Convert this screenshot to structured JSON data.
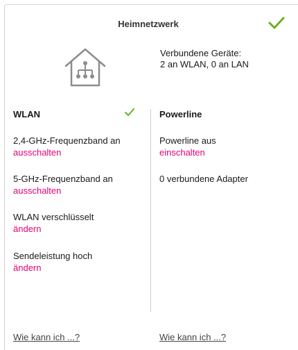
{
  "header": {
    "title": "Heimnetzwerk"
  },
  "summary": {
    "devices_line1": "Verbundene Geräte:",
    "devices_line2": "2 an WLAN, 0 an LAN"
  },
  "wlan": {
    "heading": "WLAN",
    "items": [
      {
        "status": "2,4-GHz-Frequenzband an",
        "action": "ausschalten"
      },
      {
        "status": "5-GHz-Frequenzband an",
        "action": "ausschalten"
      },
      {
        "status": "WLAN verschlüsselt",
        "action": "ändern"
      },
      {
        "status": "Sendeleistung hoch",
        "action": "ändern"
      }
    ],
    "help": "Wie kann ich ...?"
  },
  "powerline": {
    "heading": "Powerline",
    "status": "Powerline aus",
    "action": "einschalten",
    "adapters": "0 verbundene Adapter",
    "help": "Wie kann ich ...?"
  },
  "colors": {
    "accent": "#e20074",
    "check": "#6ab023"
  },
  "icons": {
    "status_ok": "checkmark-icon",
    "home": "home-network-icon"
  }
}
